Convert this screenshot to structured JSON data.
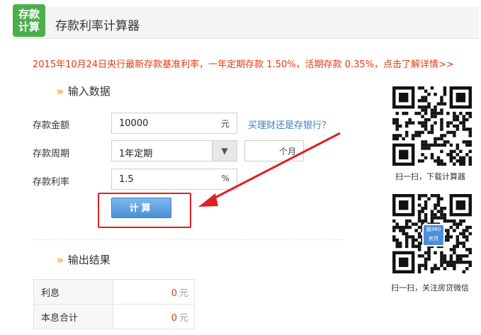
{
  "header": {
    "logo_line1": "存款",
    "logo_line2": "计算",
    "title": "存款利率计算器"
  },
  "notice": "2015年10月24日央行最新存款基准利率，一年定期存款 1.50%，活期存款 0.35%，点击了解详情>>",
  "input_section": {
    "title": "输入数据",
    "arrow": "»"
  },
  "fields": {
    "amount": {
      "label": "存款金额",
      "value": "10000",
      "unit": "元"
    },
    "period": {
      "label": "存款周期",
      "selected": "1年定期",
      "arrow": "▼",
      "custom_unit": "个月"
    },
    "rate": {
      "label": "存款利率",
      "value": "1.5",
      "unit": "%"
    }
  },
  "link": "买理财还是存银行？",
  "calc_button": "计算",
  "output_section": {
    "title": "输出结果",
    "arrow": "»"
  },
  "results": [
    {
      "label": "利息",
      "value": "0",
      "unit": "元"
    },
    {
      "label": "本息合计",
      "value": "0",
      "unit": "元"
    }
  ],
  "qr": {
    "top_caption": "扫一扫，下载计算器",
    "bottom_caption": "扫一扫，关注房贷微信",
    "bottom_badge_line1": "融360",
    "bottom_badge_line2": "房贷"
  },
  "colors": {
    "accent": "#e8380d",
    "brand_green": "#4cae4c",
    "link": "#3b7fc4",
    "button": "#4a8fd8",
    "highlight": "#e01f1f"
  }
}
